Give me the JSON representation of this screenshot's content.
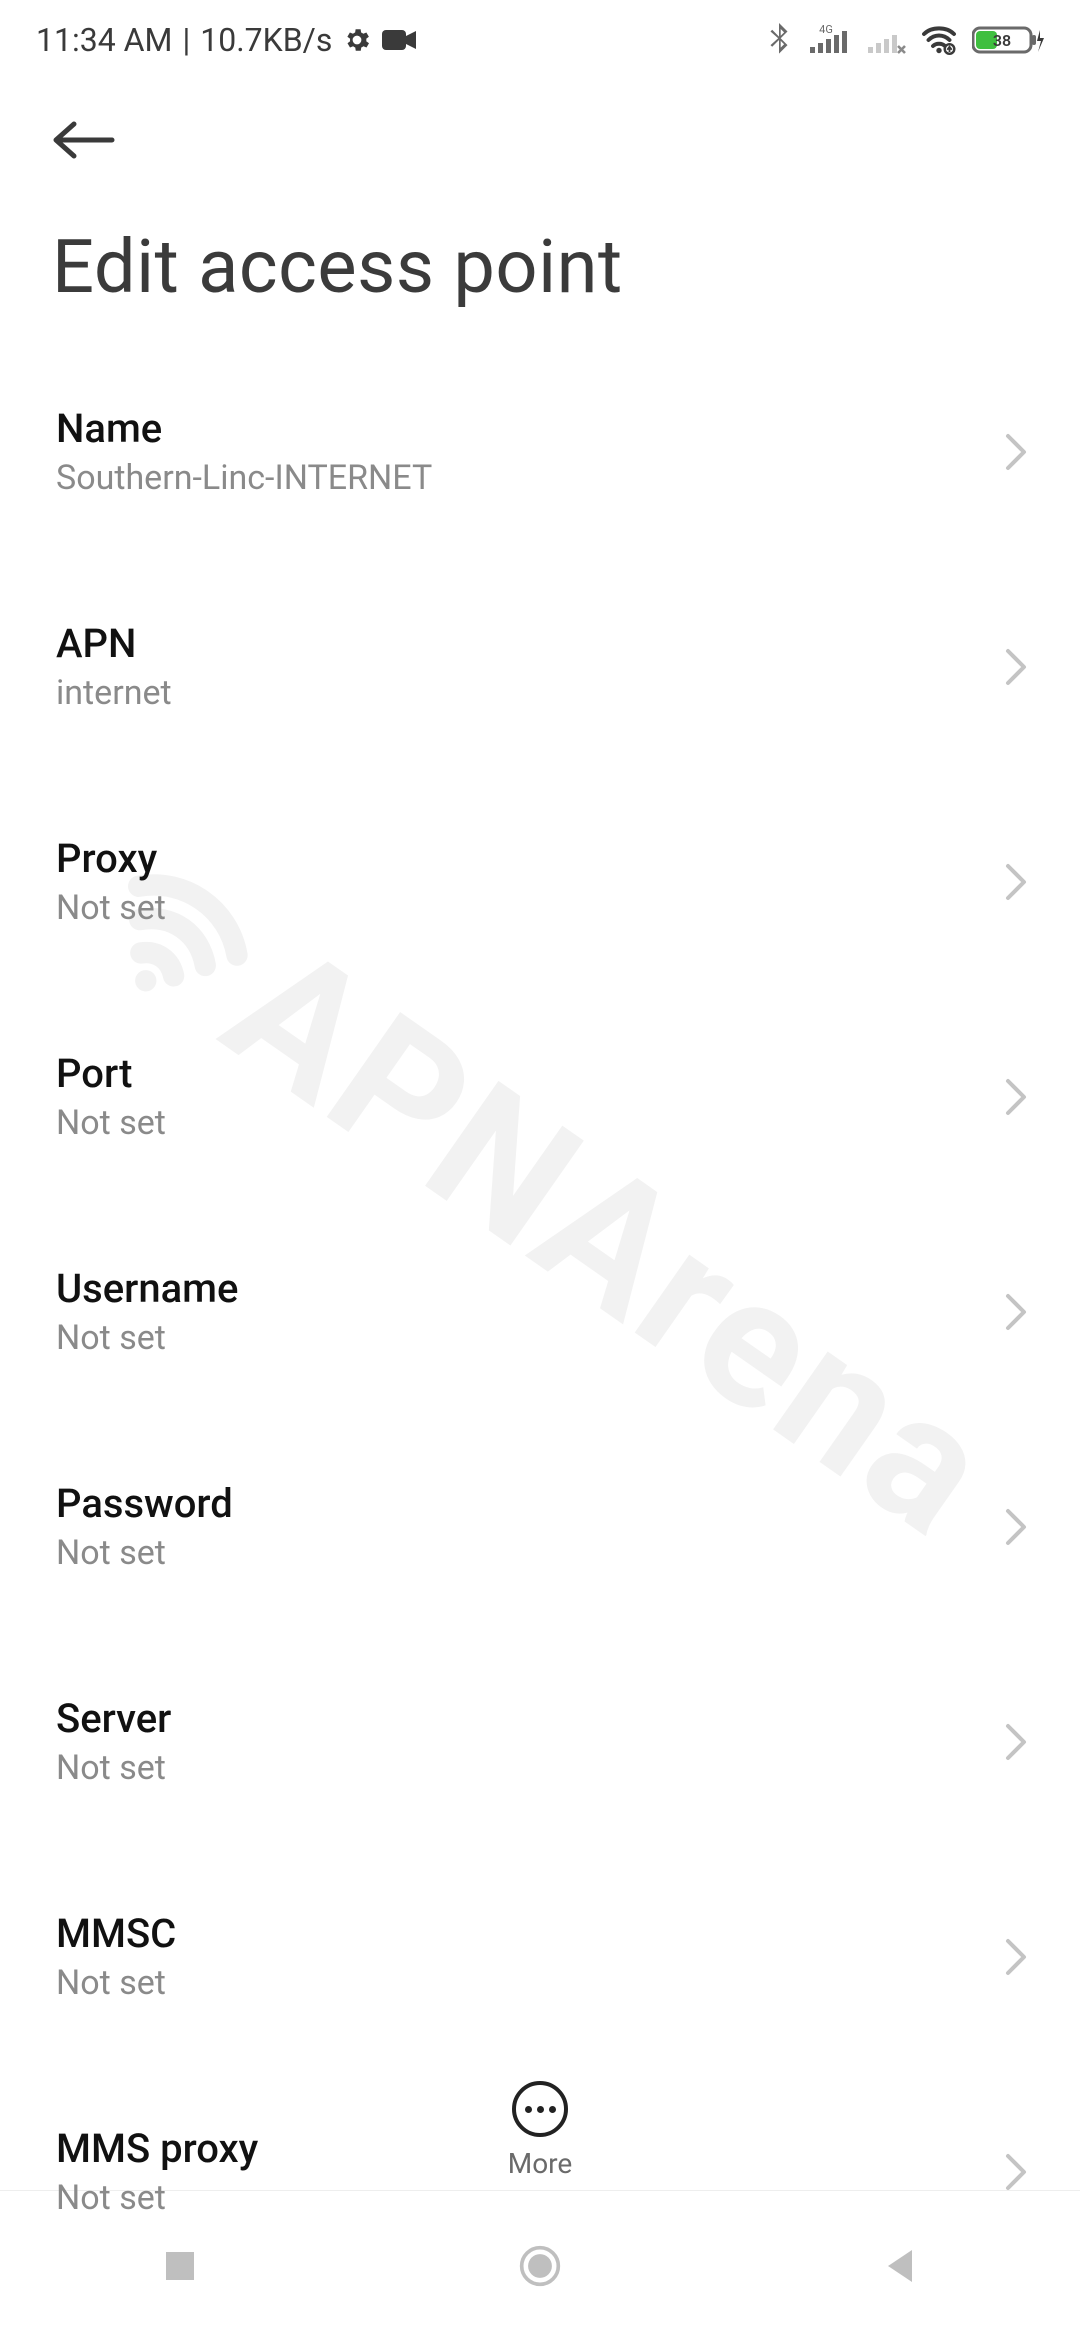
{
  "status_bar": {
    "time": "11:34 AM",
    "net_speed": "10.7KB/s",
    "battery_percent": "38"
  },
  "page": {
    "title": "Edit access point"
  },
  "settings": [
    {
      "label": "Name",
      "value": "Southern-Linc-INTERNET"
    },
    {
      "label": "APN",
      "value": "internet"
    },
    {
      "label": "Proxy",
      "value": "Not set"
    },
    {
      "label": "Port",
      "value": "Not set"
    },
    {
      "label": "Username",
      "value": "Not set"
    },
    {
      "label": "Password",
      "value": "Not set"
    },
    {
      "label": "Server",
      "value": "Not set"
    },
    {
      "label": "MMSC",
      "value": "Not set"
    },
    {
      "label": "MMS proxy",
      "value": "Not set"
    }
  ],
  "bottom": {
    "more_label": "More"
  },
  "watermark": "APNArena"
}
